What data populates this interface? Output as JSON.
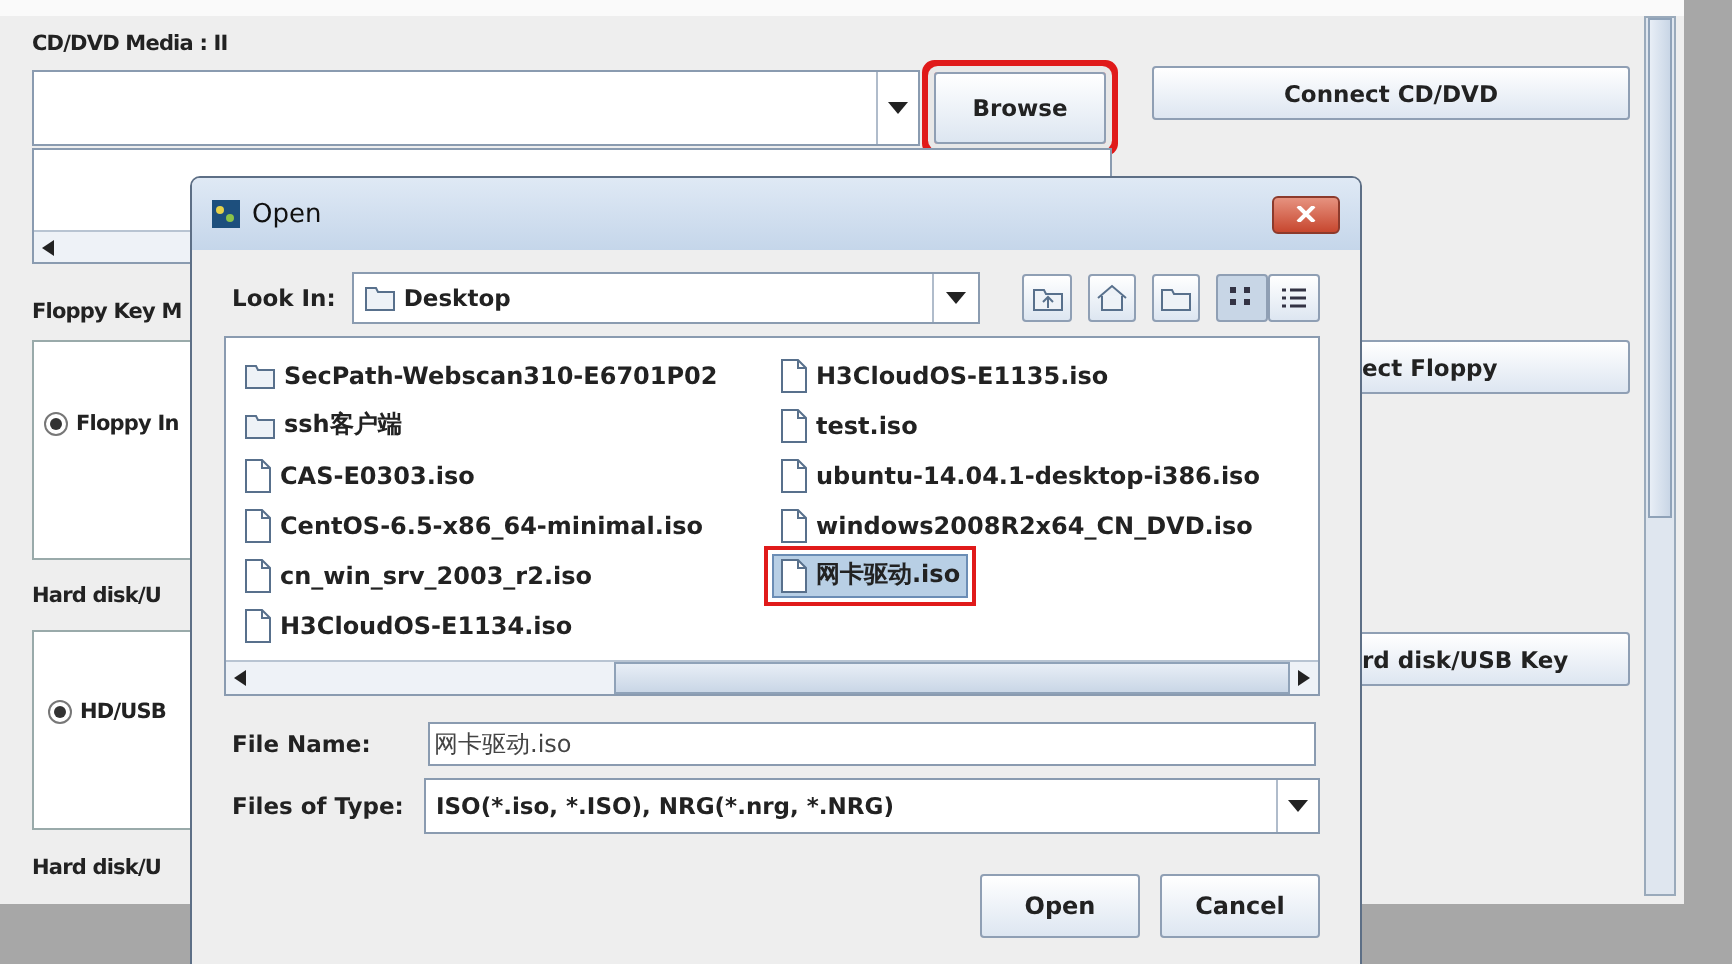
{
  "window": {
    "media_label": "CD/DVD Media : II",
    "browse_button": {
      "label": "Browse",
      "highlighted": true
    },
    "connect_cd_button": "Connect CD/DVD",
    "floppy_label": "Floppy Key M",
    "floppy_radio": {
      "label": "Floppy In",
      "selected": true
    },
    "connect_floppy_button": "ect Floppy",
    "hard_disk_label": "Hard disk/U",
    "hd_radio": {
      "label": "HD/USB",
      "selected": true
    },
    "connect_hd_button": "rd disk/USB Key",
    "hard_disk_label_2": "Hard disk/U"
  },
  "dialog": {
    "title": "Open",
    "look_in_label": "Look In:",
    "look_in_value": "Desktop",
    "files": [
      {
        "name": "SecPath-Webscan310-E6701P02",
        "kind": "folder",
        "selected": false
      },
      {
        "name": "ssh客户端",
        "kind": "folder",
        "selected": false
      },
      {
        "name": "CAS-E0303.iso",
        "kind": "file",
        "selected": false
      },
      {
        "name": "CentOS-6.5-x86_64-minimal.iso",
        "kind": "file",
        "selected": false
      },
      {
        "name": "cn_win_srv_2003_r2.iso",
        "kind": "file",
        "selected": false
      },
      {
        "name": "H3CloudOS-E1134.iso",
        "kind": "file",
        "selected": false
      },
      {
        "name": "H3CloudOS-E1135.iso",
        "kind": "file",
        "selected": false
      },
      {
        "name": "test.iso",
        "kind": "file",
        "selected": false
      },
      {
        "name": "ubuntu-14.04.1-desktop-i386.iso",
        "kind": "file",
        "selected": false
      },
      {
        "name": "windows2008R2x64_CN_DVD.iso",
        "kind": "file",
        "selected": false
      },
      {
        "name": "网卡驱动.iso",
        "kind": "file",
        "selected": true
      }
    ],
    "file_name_label": "File Name:",
    "file_name_value": "网卡驱动.iso",
    "files_of_type_label": "Files of Type:",
    "files_of_type_value": "ISO(*.iso, *.ISO), NRG(*.nrg, *.NRG)",
    "buttons": [
      "Open",
      "Cancel"
    ]
  }
}
